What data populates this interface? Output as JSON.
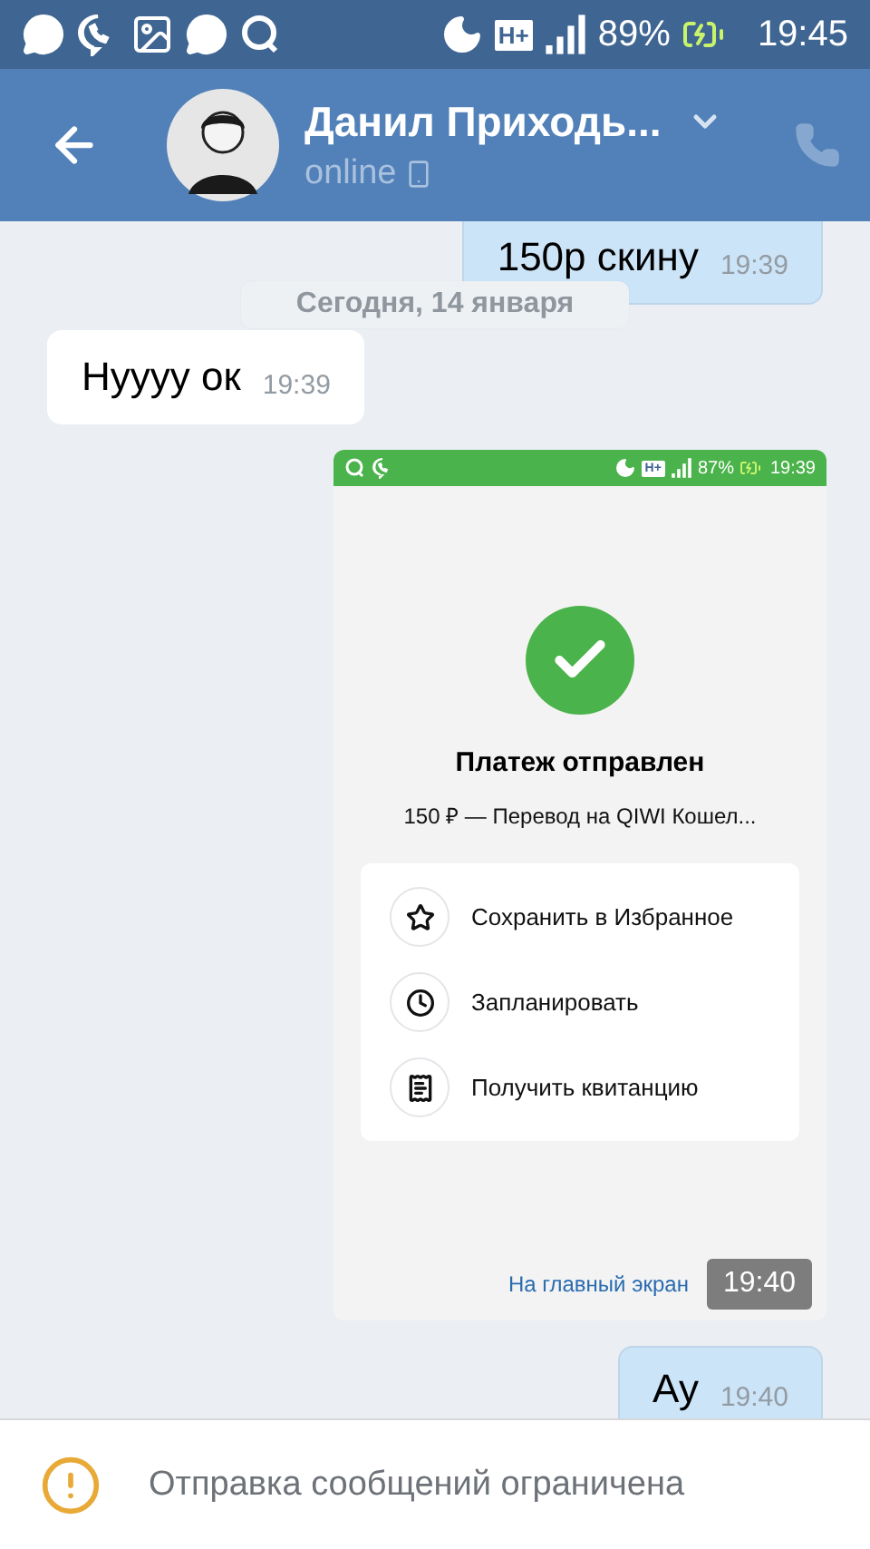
{
  "status_bar": {
    "network": "H+",
    "battery": "89%",
    "time": "19:45"
  },
  "header": {
    "name": "Данил Приходь...",
    "status": "online"
  },
  "date_label": "Сегодня, 14 января",
  "messages": [
    {
      "kind": "text",
      "outgoing": true,
      "text": "150р скину",
      "time": "19:39"
    },
    {
      "kind": "text",
      "outgoing": false,
      "text": "Нуууу ок",
      "time": "19:39"
    },
    {
      "kind": "screenshot",
      "outgoing": true,
      "time": "19:40",
      "screenshot": {
        "status_bar": {
          "network": "H+",
          "battery": "87%",
          "time": "19:39"
        },
        "title": "Платеж отправлен",
        "subtitle": "150 ₽ — Перевод на QIWI Кошел...",
        "actions": [
          {
            "kind": "star",
            "label": "Сохранить в Избранное"
          },
          {
            "kind": "clock",
            "label": "Запланировать"
          },
          {
            "kind": "receipt",
            "label": "Получить квитанцию"
          }
        ],
        "link": "На главный экран"
      }
    },
    {
      "kind": "text",
      "outgoing": true,
      "text": "Ау",
      "time": "19:40"
    }
  ],
  "notice": {
    "text": "Отправка сообщений ограничена"
  }
}
